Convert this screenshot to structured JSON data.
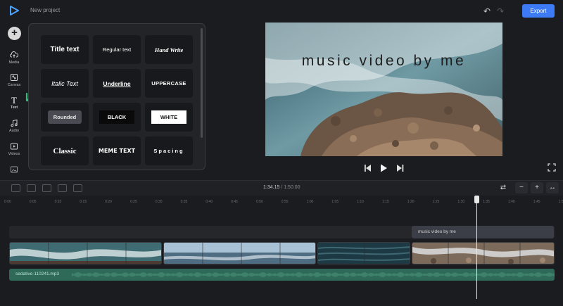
{
  "header": {
    "project_name": "New project",
    "export_label": "Export"
  },
  "rail": {
    "items": [
      {
        "label": "Media",
        "icon": "upload-cloud-icon"
      },
      {
        "label": "Canvas",
        "icon": "canvas-resize-icon"
      },
      {
        "label": "Text",
        "icon": "text-icon"
      },
      {
        "label": "Audio",
        "icon": "music-note-icon"
      },
      {
        "label": "Videos",
        "icon": "video-icon"
      },
      {
        "label": "",
        "icon": "image-icon"
      }
    ]
  },
  "text_styles": [
    {
      "label": "Title text"
    },
    {
      "label": "Regular text"
    },
    {
      "label": "Hand Write"
    },
    {
      "label": "Italic Text"
    },
    {
      "label": "Underline"
    },
    {
      "label": "UPPERCASE"
    },
    {
      "label": "Rounded"
    },
    {
      "label": "BLACK"
    },
    {
      "label": "WHITE"
    },
    {
      "label": "Classic"
    },
    {
      "label": "MEME TEXT"
    },
    {
      "label": "Spacing"
    }
  ],
  "preview": {
    "overlay_text": "music video by me"
  },
  "timeline": {
    "current_time": "1:34.15",
    "separator": "/",
    "total_time": "1:50.00",
    "ticks": [
      "0:00",
      "0:05",
      "0:10",
      "0:15",
      "0:20",
      "0:25",
      "0:30",
      "0:35",
      "0:40",
      "0:45",
      "0:50",
      "0:55",
      "1:00",
      "1:05",
      "1:10",
      "1:15",
      "1:20",
      "1:25",
      "1:30",
      "1:35",
      "1:40",
      "1:45",
      "1:50"
    ],
    "text_clip_label": "music video by me",
    "audio_clip_label": "sedative-110241.mp3"
  },
  "colors": {
    "accent": "#3d7bf6",
    "audio": "#2e6a57",
    "arrow": "#25c27a"
  }
}
